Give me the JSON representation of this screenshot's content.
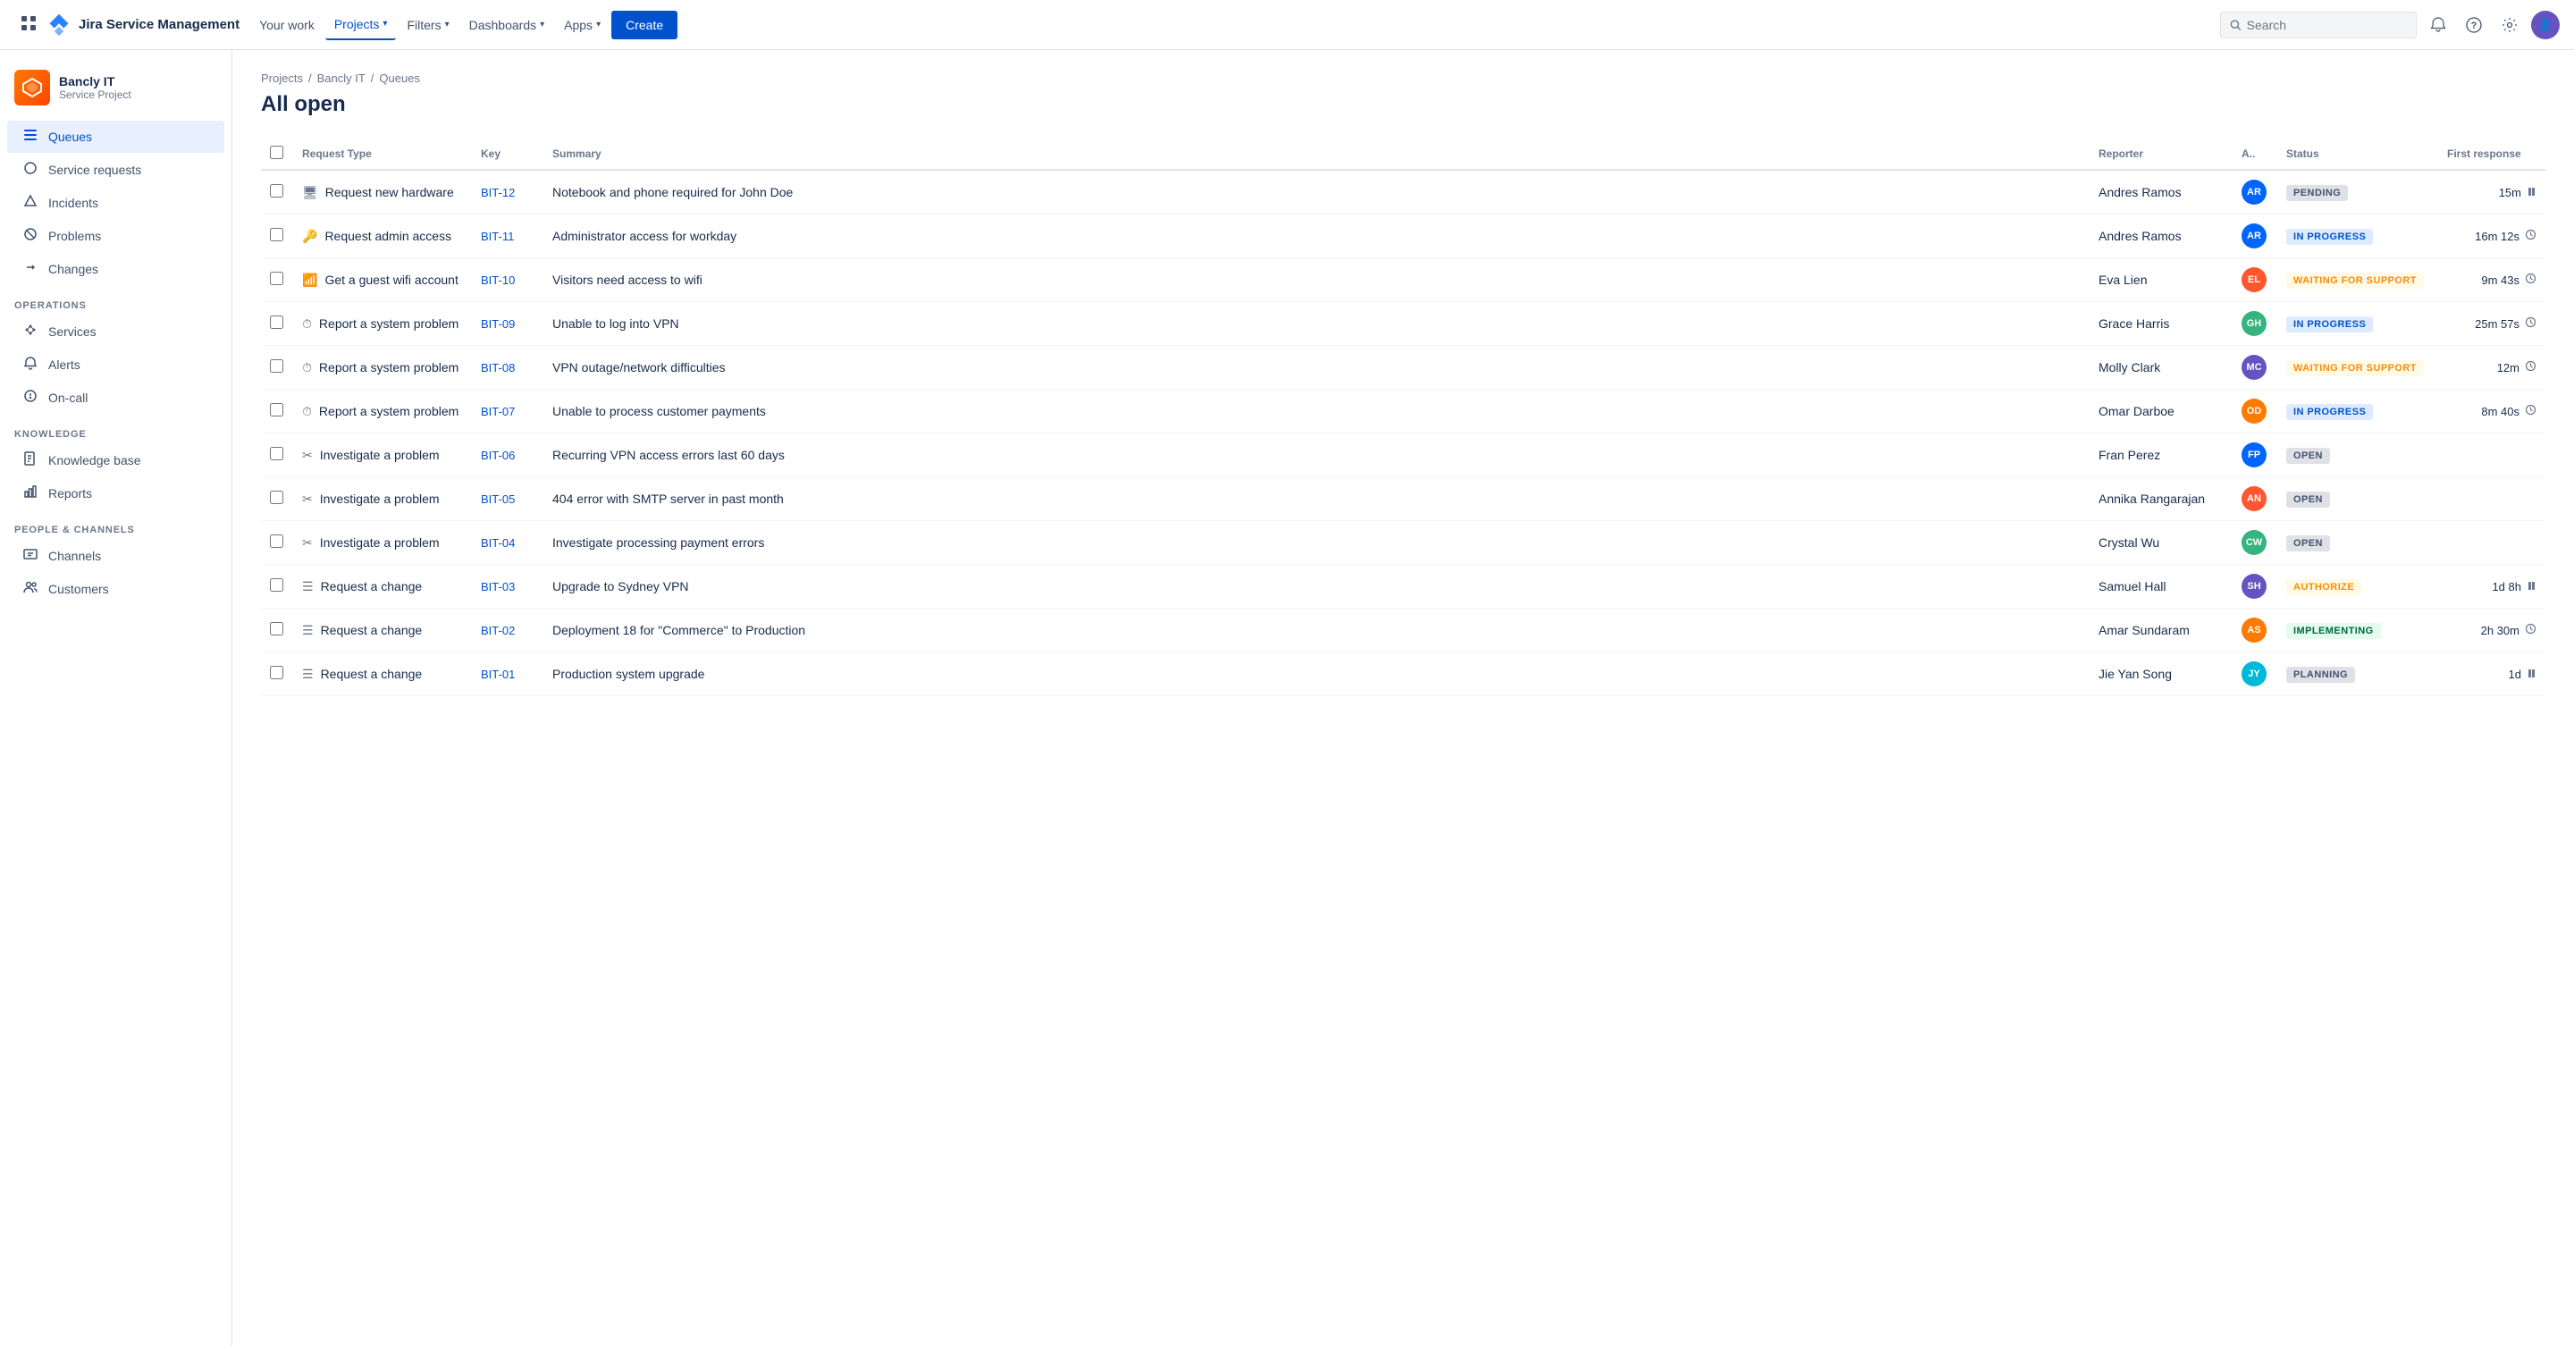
{
  "topnav": {
    "logo_text": "Jira Service Management",
    "links": [
      {
        "label": "Your work",
        "active": false
      },
      {
        "label": "Projects",
        "active": true,
        "has_chevron": true
      },
      {
        "label": "Filters",
        "active": false,
        "has_chevron": true
      },
      {
        "label": "Dashboards",
        "active": false,
        "has_chevron": true
      },
      {
        "label": "Apps",
        "active": false,
        "has_chevron": true
      }
    ],
    "create_label": "Create",
    "search_placeholder": "Search"
  },
  "sidebar": {
    "project_name": "Bancly IT",
    "project_type": "Service Project",
    "nav_items": [
      {
        "label": "Queues",
        "active": true,
        "icon": "☰"
      },
      {
        "label": "Service requests",
        "active": false,
        "icon": "○"
      },
      {
        "label": "Incidents",
        "active": false,
        "icon": "△"
      },
      {
        "label": "Problems",
        "active": false,
        "icon": "⊘"
      },
      {
        "label": "Changes",
        "active": false,
        "icon": "⟳"
      }
    ],
    "operations_label": "OPERATIONS",
    "operations_items": [
      {
        "label": "Services",
        "active": false,
        "icon": "⋮"
      },
      {
        "label": "Alerts",
        "active": false,
        "icon": "🔔"
      },
      {
        "label": "On-call",
        "active": false,
        "icon": "⊕"
      }
    ],
    "knowledge_label": "KNOWLEDGE",
    "knowledge_items": [
      {
        "label": "Knowledge base",
        "active": false,
        "icon": "📋"
      },
      {
        "label": "Reports",
        "active": false,
        "icon": "📊"
      }
    ],
    "people_label": "PEOPLE & CHANNELS",
    "people_items": [
      {
        "label": "Channels",
        "active": false,
        "icon": "🖥"
      },
      {
        "label": "Customers",
        "active": false,
        "icon": "👥"
      }
    ]
  },
  "breadcrumb": {
    "items": [
      "Projects",
      "Bancly IT",
      "Queues"
    ]
  },
  "page": {
    "title": "All open"
  },
  "table": {
    "columns": [
      "Request Type",
      "Key",
      "Summary",
      "Reporter",
      "A..",
      "Status",
      "First response"
    ],
    "rows": [
      {
        "type_icon": "🖥",
        "type": "Request new hardware",
        "key": "BIT-12",
        "summary": "Notebook and phone required for John Doe",
        "reporter": "Andres Ramos",
        "avatar_color": "#0065ff",
        "avatar_text": "AR",
        "status": "PENDING",
        "status_class": "status-pending",
        "response": "15m",
        "response_icon": "pause"
      },
      {
        "type_icon": "🔑",
        "type": "Request admin access",
        "key": "BIT-11",
        "summary": "Administrator access for workday",
        "reporter": "Andres Ramos",
        "avatar_color": "#0065ff",
        "avatar_text": "AR",
        "status": "IN PROGRESS",
        "status_class": "status-in-progress",
        "response": "16m 12s",
        "response_icon": "clock"
      },
      {
        "type_icon": "📶",
        "type": "Get a guest wifi account",
        "key": "BIT-10",
        "summary": "Visitors need access to wifi",
        "reporter": "Eva Lien",
        "avatar_color": "#ff5630",
        "avatar_text": "EL",
        "status": "WAITING FOR SUPPORT",
        "status_class": "status-waiting",
        "response": "9m 43s",
        "response_icon": "clock"
      },
      {
        "type_icon": "⏱",
        "type": "Report a system problem",
        "key": "BIT-09",
        "summary": "Unable to log into VPN",
        "reporter": "Grace Harris",
        "avatar_color": "#36b37e",
        "avatar_text": "GH",
        "status": "IN PROGRESS",
        "status_class": "status-in-progress",
        "response": "25m 57s",
        "response_icon": "clock"
      },
      {
        "type_icon": "⏱",
        "type": "Report a system problem",
        "key": "BIT-08",
        "summary": "VPN outage/network difficulties",
        "reporter": "Molly Clark",
        "avatar_color": "#6554c0",
        "avatar_text": "MC",
        "status": "WAITING FOR SUPPORT",
        "status_class": "status-waiting",
        "response": "12m",
        "response_icon": "clock"
      },
      {
        "type_icon": "⏱",
        "type": "Report a system problem",
        "key": "BIT-07",
        "summary": "Unable to process customer payments",
        "reporter": "Omar Darboe",
        "avatar_color": "#ff7a00",
        "avatar_text": "OD",
        "status": "IN PROGRESS",
        "status_class": "status-in-progress",
        "response": "8m 40s",
        "response_icon": "clock"
      },
      {
        "type_icon": "✂",
        "type": "Investigate a problem",
        "key": "BIT-06",
        "summary": "Recurring VPN access errors last 60 days",
        "reporter": "Fran Perez",
        "avatar_color": "#0065ff",
        "avatar_text": "FP",
        "status": "OPEN",
        "status_class": "status-open",
        "response": "",
        "response_icon": ""
      },
      {
        "type_icon": "✂",
        "type": "Investigate a problem",
        "key": "BIT-05",
        "summary": "404 error with SMTP server in past month",
        "reporter": "Annika Rangarajan",
        "avatar_color": "#ff5630",
        "avatar_text": "AN",
        "status": "OPEN",
        "status_class": "status-open",
        "response": "",
        "response_icon": ""
      },
      {
        "type_icon": "✂",
        "type": "Investigate a problem",
        "key": "BIT-04",
        "summary": "Investigate processing payment errors",
        "reporter": "Crystal Wu",
        "avatar_color": "#36b37e",
        "avatar_text": "CW",
        "status": "OPEN",
        "status_class": "status-open",
        "response": "",
        "response_icon": ""
      },
      {
        "type_icon": "☰",
        "type": "Request a change",
        "key": "BIT-03",
        "summary": "Upgrade to Sydney VPN",
        "reporter": "Samuel Hall",
        "avatar_color": "#6554c0",
        "avatar_text": "SH",
        "status": "AUTHORIZE",
        "status_class": "status-authorize",
        "response": "1d 8h",
        "response_icon": "pause"
      },
      {
        "type_icon": "☰",
        "type": "Request a change",
        "key": "BIT-02",
        "summary": "Deployment 18 for \"Commerce\" to Production",
        "reporter": "Amar Sundaram",
        "avatar_color": "#ff7a00",
        "avatar_text": "AS",
        "status": "IMPLEMENTING",
        "status_class": "status-implementing",
        "response": "2h 30m",
        "response_icon": "clock"
      },
      {
        "type_icon": "☰",
        "type": "Request a change",
        "key": "BIT-01",
        "summary": "Production system upgrade",
        "reporter": "Jie Yan Song",
        "avatar_color": "#00b8d9",
        "avatar_text": "JY",
        "status": "PLANNING",
        "status_class": "status-planning",
        "response": "1d",
        "response_icon": "pause"
      }
    ]
  }
}
